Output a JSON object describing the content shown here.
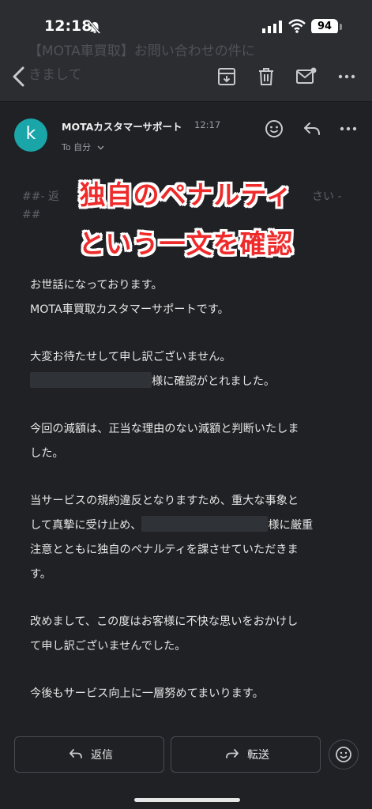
{
  "status_bar": {
    "time": "12:18",
    "battery": "94"
  },
  "header": {
    "subject_ghost": "【MOTA車買取】お問い合わせの件に",
    "subject_ghost2": "きまして"
  },
  "message": {
    "avatar_letter": "k",
    "sender": "MOTAカスタマーサポート",
    "time": "12:17",
    "to": "To 自分",
    "ghost_line1": "##- 返",
    "ghost_right": "さい -",
    "ghost_line2": "##"
  },
  "overlay": {
    "line1": "独自のペナルティ",
    "line2": "という一文を確認"
  },
  "body": {
    "p1_l1": "お世話になっております。",
    "p1_l2": "MOTA車買取カスタマーサポートです。",
    "p2_l1": "大変お待たせして申し訳ございません。",
    "p2_l2_suffix": "様に確認がとれました。",
    "p3_l1": "今回の減額は、正当な理由のない減額と判断いたしま",
    "p3_l2": "した。",
    "p4_l1": "当サービスの規約違反となりますため、重大な事象と",
    "p4_l2_prefix": "して真摯に受け止め、",
    "p4_l2_suffix": "様に厳重",
    "p4_l3": "注意とともに独自のペナルティを課させていただきま",
    "p4_l4": "す。",
    "p5_l1": "改めまして、この度はお客様に不快な思いをおかけし",
    "p5_l2": "て申し訳ございませんでした。",
    "p6_l1": "今後もサービス向上に一層努めてまいります。"
  },
  "actions": {
    "reply_label": "返信",
    "forward_label": "転送"
  }
}
